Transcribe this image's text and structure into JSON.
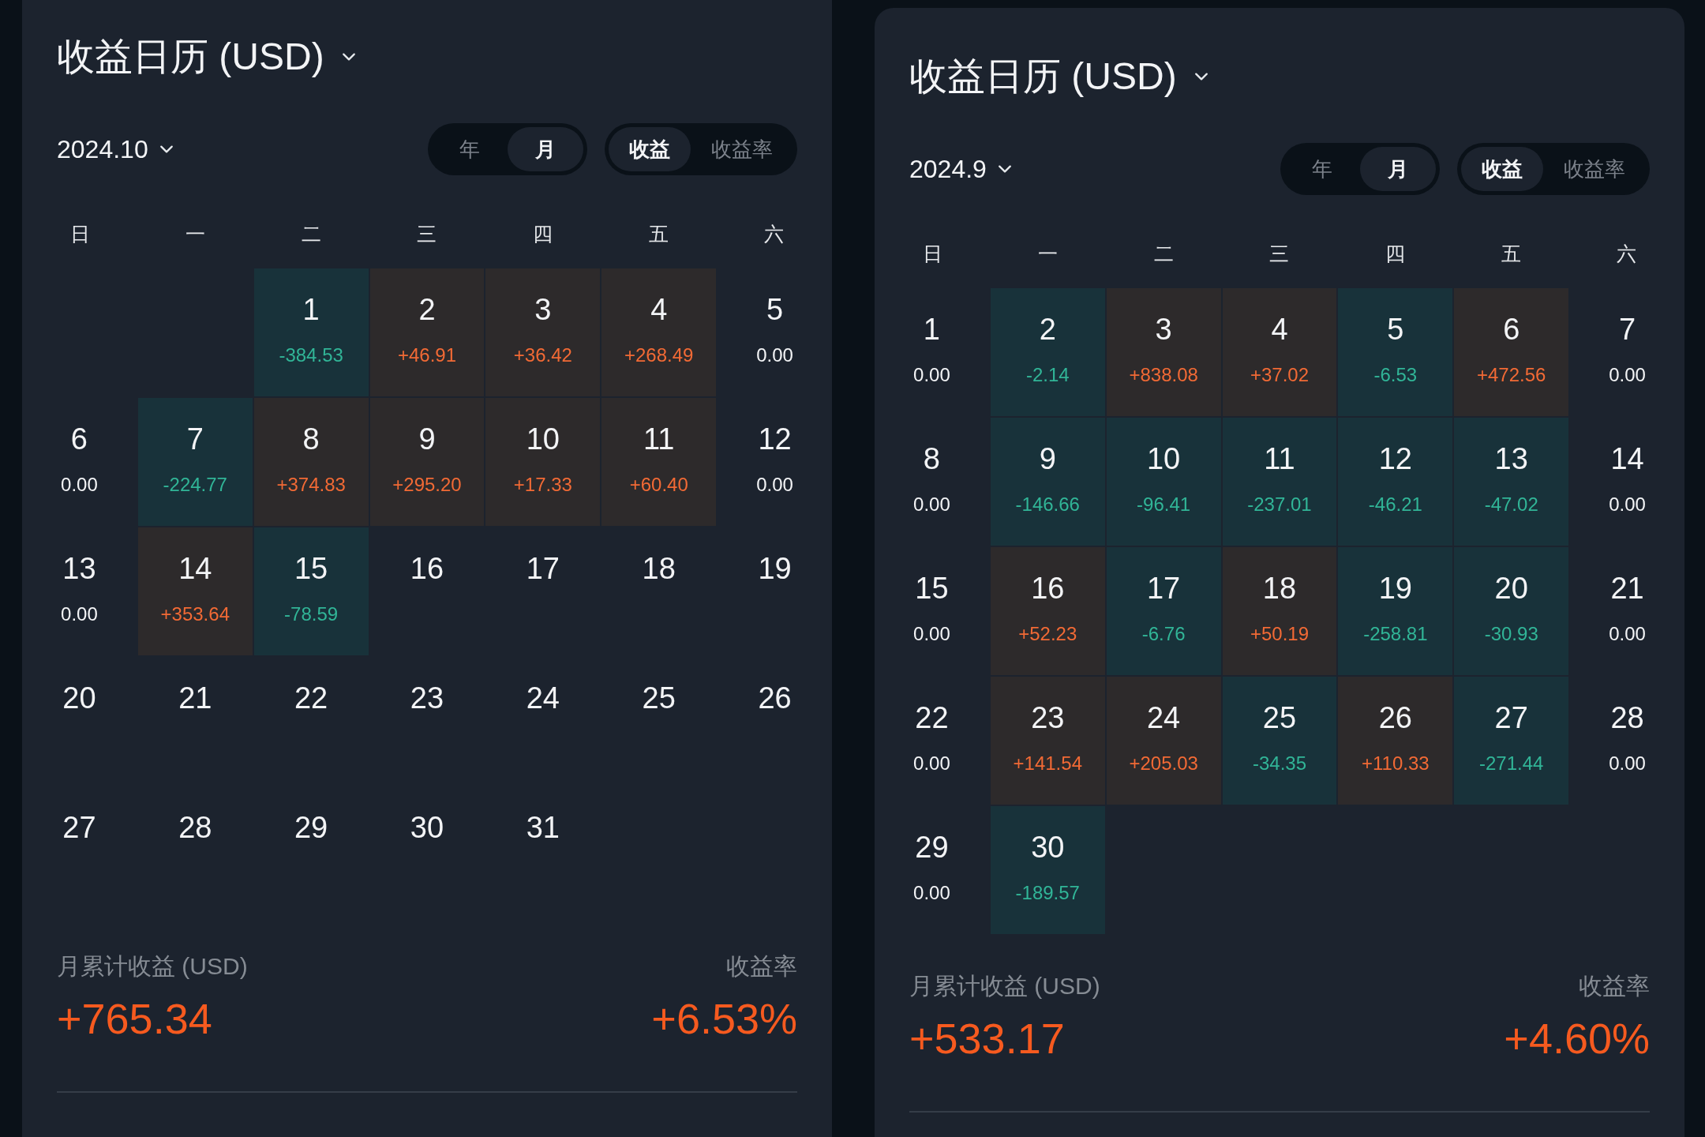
{
  "panels": [
    {
      "title": "收益日历 (USD)",
      "period": "2024.10",
      "range_tabs": [
        {
          "label": "年",
          "selected": false
        },
        {
          "label": "月",
          "selected": true
        }
      ],
      "metric_tabs": [
        {
          "label": "收益",
          "selected": true
        },
        {
          "label": "收益率",
          "selected": false
        }
      ],
      "weekdays": [
        "日",
        "一",
        "二",
        "三",
        "四",
        "五",
        "六"
      ],
      "days": [
        {
          "kind": "blank"
        },
        {
          "kind": "blank"
        },
        {
          "kind": "loss",
          "day": "1",
          "value": "-384.53"
        },
        {
          "kind": "gain",
          "day": "2",
          "value": "+46.91"
        },
        {
          "kind": "gain",
          "day": "3",
          "value": "+36.42"
        },
        {
          "kind": "gain",
          "day": "4",
          "value": "+268.49"
        },
        {
          "kind": "zero",
          "day": "5",
          "value": "0.00"
        },
        {
          "kind": "zero",
          "day": "6",
          "value": "0.00"
        },
        {
          "kind": "loss",
          "day": "7",
          "value": "-224.77"
        },
        {
          "kind": "gain",
          "day": "8",
          "value": "+374.83"
        },
        {
          "kind": "gain",
          "day": "9",
          "value": "+295.20"
        },
        {
          "kind": "gain",
          "day": "10",
          "value": "+17.33"
        },
        {
          "kind": "gain",
          "day": "11",
          "value": "+60.40"
        },
        {
          "kind": "zero",
          "day": "12",
          "value": "0.00"
        },
        {
          "kind": "zero",
          "day": "13",
          "value": "0.00"
        },
        {
          "kind": "gain",
          "day": "14",
          "value": "+353.64"
        },
        {
          "kind": "loss",
          "day": "15",
          "value": "-78.59"
        },
        {
          "kind": "plain",
          "day": "16"
        },
        {
          "kind": "plain",
          "day": "17"
        },
        {
          "kind": "plain",
          "day": "18"
        },
        {
          "kind": "plain",
          "day": "19"
        },
        {
          "kind": "plain",
          "day": "20"
        },
        {
          "kind": "plain",
          "day": "21"
        },
        {
          "kind": "plain",
          "day": "22"
        },
        {
          "kind": "plain",
          "day": "23"
        },
        {
          "kind": "plain",
          "day": "24"
        },
        {
          "kind": "plain",
          "day": "25"
        },
        {
          "kind": "plain",
          "day": "26"
        },
        {
          "kind": "plain",
          "day": "27"
        },
        {
          "kind": "plain",
          "day": "28"
        },
        {
          "kind": "plain",
          "day": "29"
        },
        {
          "kind": "plain",
          "day": "30"
        },
        {
          "kind": "plain",
          "day": "31"
        }
      ],
      "summary": {
        "label": "月累计收益 (USD)",
        "value": "+765.34",
        "rate_label": "收益率",
        "rate_value": "+6.53%",
        "kind": "gain"
      }
    },
    {
      "title": "收益日历 (USD)",
      "period": "2024.9",
      "range_tabs": [
        {
          "label": "年",
          "selected": false
        },
        {
          "label": "月",
          "selected": true
        }
      ],
      "metric_tabs": [
        {
          "label": "收益",
          "selected": true
        },
        {
          "label": "收益率",
          "selected": false
        }
      ],
      "weekdays": [
        "日",
        "一",
        "二",
        "三",
        "四",
        "五",
        "六"
      ],
      "days": [
        {
          "kind": "zero",
          "day": "1",
          "value": "0.00"
        },
        {
          "kind": "loss",
          "day": "2",
          "value": "-2.14"
        },
        {
          "kind": "gain",
          "day": "3",
          "value": "+838.08"
        },
        {
          "kind": "gain",
          "day": "4",
          "value": "+37.02"
        },
        {
          "kind": "loss",
          "day": "5",
          "value": "-6.53"
        },
        {
          "kind": "gain",
          "day": "6",
          "value": "+472.56"
        },
        {
          "kind": "zero",
          "day": "7",
          "value": "0.00"
        },
        {
          "kind": "zero",
          "day": "8",
          "value": "0.00"
        },
        {
          "kind": "loss",
          "day": "9",
          "value": "-146.66"
        },
        {
          "kind": "loss",
          "day": "10",
          "value": "-96.41"
        },
        {
          "kind": "loss",
          "day": "11",
          "value": "-237.01"
        },
        {
          "kind": "loss",
          "day": "12",
          "value": "-46.21"
        },
        {
          "kind": "loss",
          "day": "13",
          "value": "-47.02"
        },
        {
          "kind": "zero",
          "day": "14",
          "value": "0.00"
        },
        {
          "kind": "zero",
          "day": "15",
          "value": "0.00"
        },
        {
          "kind": "gain",
          "day": "16",
          "value": "+52.23"
        },
        {
          "kind": "loss",
          "day": "17",
          "value": "-6.76"
        },
        {
          "kind": "gain",
          "day": "18",
          "value": "+50.19"
        },
        {
          "kind": "loss",
          "day": "19",
          "value": "-258.81"
        },
        {
          "kind": "loss",
          "day": "20",
          "value": "-30.93"
        },
        {
          "kind": "zero",
          "day": "21",
          "value": "0.00"
        },
        {
          "kind": "zero",
          "day": "22",
          "value": "0.00"
        },
        {
          "kind": "gain",
          "day": "23",
          "value": "+141.54"
        },
        {
          "kind": "gain",
          "day": "24",
          "value": "+205.03"
        },
        {
          "kind": "loss",
          "day": "25",
          "value": "-34.35"
        },
        {
          "kind": "gain",
          "day": "26",
          "value": "+110.33"
        },
        {
          "kind": "loss",
          "day": "27",
          "value": "-271.44"
        },
        {
          "kind": "zero",
          "day": "28",
          "value": "0.00"
        },
        {
          "kind": "zero",
          "day": "29",
          "value": "0.00"
        },
        {
          "kind": "loss",
          "day": "30",
          "value": "-189.57"
        }
      ],
      "summary": {
        "label": "月累计收益 (USD)",
        "value": "+533.17",
        "rate_label": "收益率",
        "rate_value": "+4.60%",
        "kind": "gain"
      }
    }
  ]
}
